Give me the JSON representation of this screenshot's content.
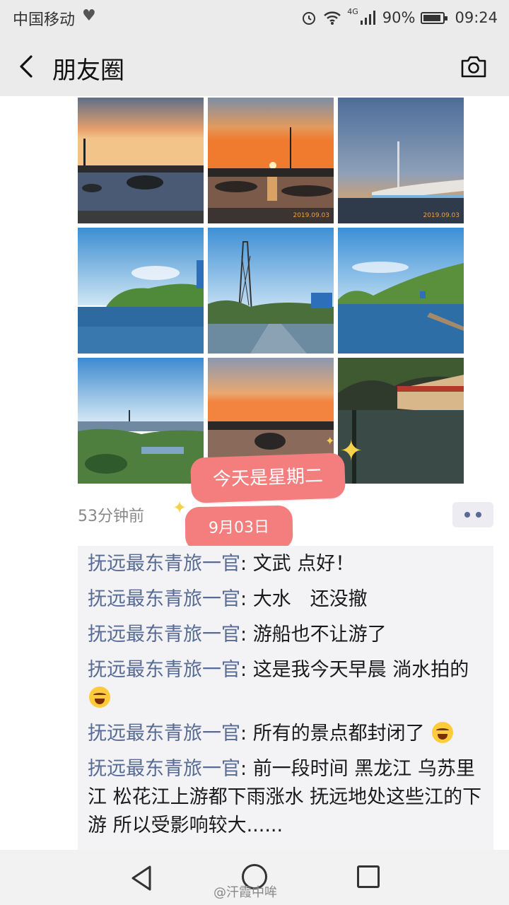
{
  "status_bar": {
    "carrier": "中国移动",
    "network": "4G",
    "battery": "90%",
    "battery_level": 0.9,
    "time": "09:24"
  },
  "nav": {
    "title": "朋友圈",
    "back_icon": "back-arrow-icon",
    "camera_icon": "camera-icon"
  },
  "photos": [
    {
      "scene": "sunset-lake-tower",
      "stamp": ""
    },
    {
      "scene": "sunset-sun-flood",
      "stamp": "2019.09.03"
    },
    {
      "scene": "bridge-dusk",
      "stamp": "2019.09.03"
    },
    {
      "scene": "flooded-trees",
      "stamp": ""
    },
    {
      "scene": "flooded-road-tower",
      "stamp": ""
    },
    {
      "scene": "flooded-shore",
      "stamp": ""
    },
    {
      "scene": "wetland-view",
      "stamp": ""
    },
    {
      "scene": "sunset-water",
      "stamp": ""
    },
    {
      "scene": "flooded-wall",
      "stamp": ""
    }
  ],
  "stickers": {
    "line1": "今天是星期二",
    "line2": "9月03日"
  },
  "post": {
    "time": "53分钟前"
  },
  "comments": [
    {
      "author": "抚远最东青旅一官",
      "text": "文武 点好！",
      "emoji": false
    },
    {
      "author": "抚远最东青旅一官",
      "text": "大水　还没撤",
      "emoji": false
    },
    {
      "author": "抚远最东青旅一官",
      "text": "游船也不让游了",
      "emoji": false
    },
    {
      "author": "抚远最东青旅一官",
      "text": "这是我今天早晨 淌水拍的",
      "emoji": true
    },
    {
      "author": "抚远最东青旅一官",
      "text": "所有的景点都封闭了",
      "emoji": true
    },
    {
      "author": "抚远最东青旅一官",
      "text": "前一段时间 黑龙江 乌苏里江 松花江上游都下雨涨水  抚远地处这些江的下游 所以受影响较大......",
      "emoji": false
    }
  ],
  "watermark": "@汗霞中哞",
  "colors": {
    "author_link": "#576b95",
    "sticker": "#f47d7d",
    "bar_bg": "#ebebeb"
  }
}
